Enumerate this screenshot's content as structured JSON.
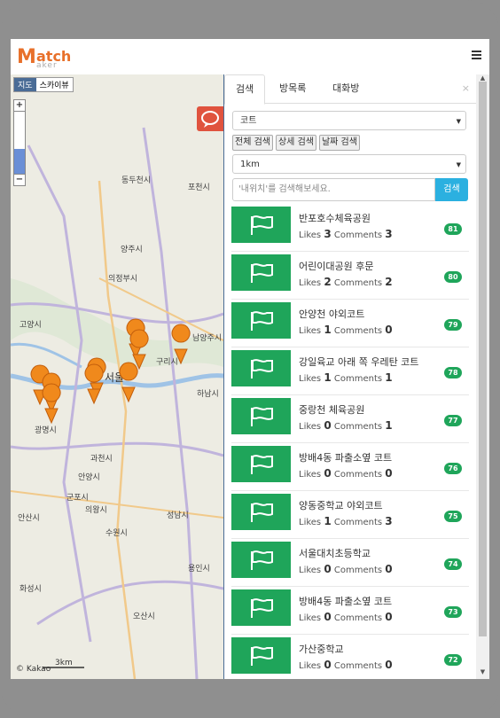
{
  "header": {
    "logo_m": "M",
    "logo_atch": "atch",
    "logo_aker": "aker",
    "menu_icon": "hamburger-icon"
  },
  "map": {
    "type_buttons": [
      "지도",
      "스카이뷰"
    ],
    "labels": [
      "동두천시",
      "포천시",
      "양주시",
      "의정부시",
      "고양시",
      "남양주시",
      "서울",
      "구리시",
      "하남시",
      "광명시",
      "과천시",
      "안양시",
      "군포시",
      "의왕시",
      "안산시",
      "수원시",
      "성남시",
      "화성시",
      "오산시",
      "용인시"
    ],
    "copyright": "© Kakao",
    "scale": "3km"
  },
  "panel": {
    "tabs": [
      "검색",
      "방목록",
      "대화방"
    ],
    "active_tab": "검색",
    "close": "×",
    "category_select": "코트",
    "filter_buttons": [
      "전체 검색",
      "상세 검색",
      "날짜 검색"
    ],
    "distance_select": "1km",
    "search_placeholder": "'내위치'를 검색해보세요.",
    "search_button": "검색",
    "likes_label": "Likes",
    "comments_label": "Comments",
    "items": [
      {
        "name": "반포호수체육공원",
        "likes": "3",
        "comments": "3",
        "badge": "81"
      },
      {
        "name": "어린이대공원 후문",
        "likes": "2",
        "comments": "2",
        "badge": "80"
      },
      {
        "name": "안양천 야외코트",
        "likes": "1",
        "comments": "0",
        "badge": "79"
      },
      {
        "name": "강일육교 아래 쪽 우레탄 코트",
        "likes": "1",
        "comments": "1",
        "badge": "78"
      },
      {
        "name": "중랑천 체육공원",
        "likes": "0",
        "comments": "1",
        "badge": "77"
      },
      {
        "name": "방배4동 파출소옆 코트",
        "likes": "0",
        "comments": "0",
        "badge": "76"
      },
      {
        "name": "양동중학교 야외코트",
        "likes": "1",
        "comments": "3",
        "badge": "75"
      },
      {
        "name": "서울대치초등학교",
        "likes": "0",
        "comments": "0",
        "badge": "74"
      },
      {
        "name": "방배4동 파출소옆 코트",
        "likes": "0",
        "comments": "0",
        "badge": "73"
      },
      {
        "name": "가산중학교",
        "likes": "0",
        "comments": "0",
        "badge": "72"
      }
    ]
  },
  "colors": {
    "accent_green": "#1fa55a",
    "search_blue": "#2bb0e0",
    "logo_orange": "#e8702a",
    "chat_red": "#e0533e"
  }
}
